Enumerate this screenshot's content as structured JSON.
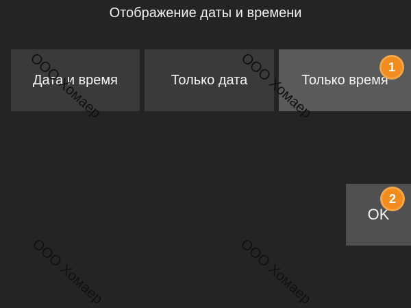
{
  "dialog": {
    "title": "Отображение даты и времени"
  },
  "modes": {
    "datetime_label": "Дата и время",
    "date_label": "Только дата",
    "time_label": "Только время",
    "selected": "Только время"
  },
  "actions": {
    "ok_label": "OK"
  },
  "annotations": {
    "badge_1": "1",
    "badge_2": "2",
    "badge_color": "#f28c1e"
  },
  "watermark": {
    "text": "ООО Хомаер"
  }
}
